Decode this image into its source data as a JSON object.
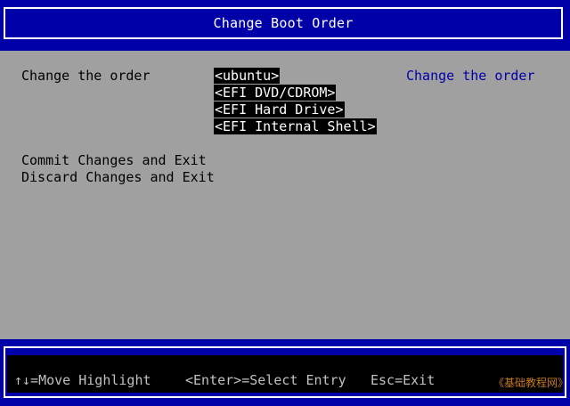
{
  "header": {
    "title": "Change Boot Order"
  },
  "main": {
    "order_label": "Change the order",
    "boot_order": [
      "<ubuntu>",
      "<EFI DVD/CDROM>",
      "<EFI Hard Drive>",
      "<EFI Internal Shell>"
    ],
    "commit_label": "Commit Changes and Exit",
    "discard_label": "Discard Changes and Exit",
    "help_text": "Change the order"
  },
  "footer": {
    "move": "↑↓=Move Highlight",
    "select": "<Enter>=Select Entry",
    "exit": "Esc=Exit",
    "watermark": "《基础教程网》"
  },
  "colors": {
    "background": "#a0a0a0",
    "header_bar": "#0000a8",
    "help_text": "#0000a8",
    "selected_bg": "#000000",
    "selected_fg": "#ffffff"
  }
}
